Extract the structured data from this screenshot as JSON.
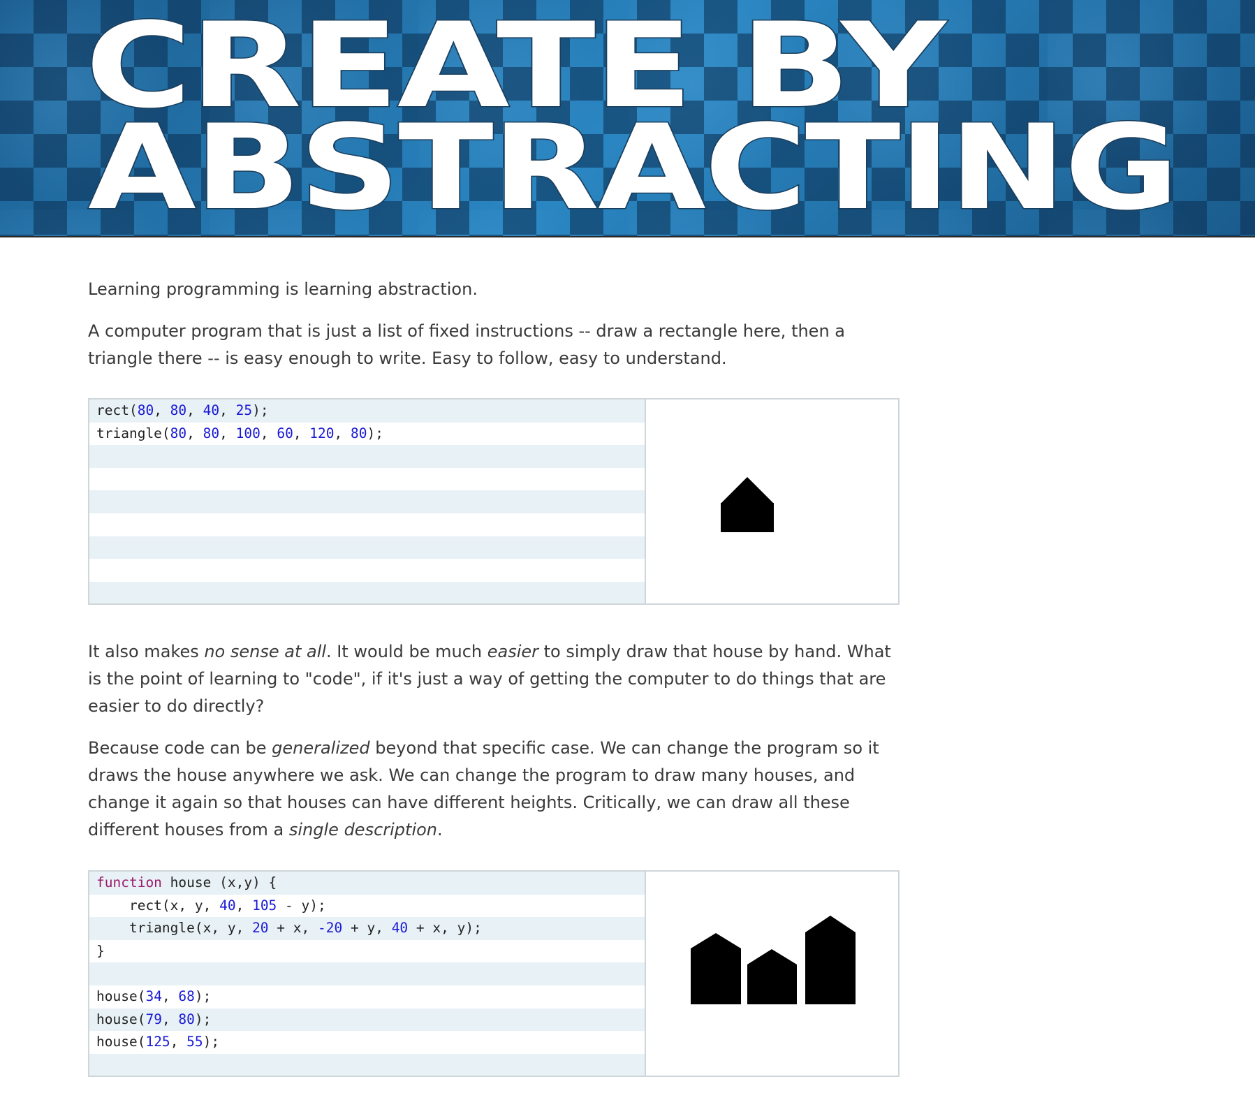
{
  "banner": {
    "line1": "CREATE BY",
    "line2": "ABSTRACTING"
  },
  "intro": {
    "p1": "Learning programming is learning abstraction.",
    "p2": "A computer program that is just a list of fixed instructions -- draw a rectangle here, then a triangle there -- is easy enough to write. Easy to follow, easy to understand."
  },
  "example1": {
    "code_lines": [
      [
        {
          "t": "rect("
        },
        {
          "t": "80",
          "n": true
        },
        {
          "t": ", "
        },
        {
          "t": "80",
          "n": true
        },
        {
          "t": ", "
        },
        {
          "t": "40",
          "n": true
        },
        {
          "t": ", "
        },
        {
          "t": "25",
          "n": true
        },
        {
          "t": ");"
        }
      ],
      [
        {
          "t": "triangle("
        },
        {
          "t": "80",
          "n": true
        },
        {
          "t": ", "
        },
        {
          "t": "80",
          "n": true
        },
        {
          "t": ", "
        },
        {
          "t": "100",
          "n": true
        },
        {
          "t": ", "
        },
        {
          "t": "60",
          "n": true
        },
        {
          "t": ", "
        },
        {
          "t": "120",
          "n": true
        },
        {
          "t": ", "
        },
        {
          "t": "80",
          "n": true
        },
        {
          "t": ");"
        }
      ],
      [],
      [],
      [],
      [],
      [],
      [],
      []
    ]
  },
  "middle": {
    "p3_parts": [
      {
        "t": "It also makes "
      },
      {
        "t": "no sense at all",
        "em": true
      },
      {
        "t": ". It would be much "
      },
      {
        "t": "easier",
        "em": true
      },
      {
        "t": " to simply draw that house by hand. What is the point of learning to \"code\", if it's just a way of getting the computer to do things that are easier to do directly?"
      }
    ],
    "p4_parts": [
      {
        "t": "Because code can be "
      },
      {
        "t": "generalized",
        "em": true
      },
      {
        "t": " beyond that specific case. We can change the program so it draws the house anywhere we ask. We can change the program to draw many houses, and change it again so that houses can have different heights. Critically, we can draw all these different houses from a "
      },
      {
        "t": "single description",
        "em": true
      },
      {
        "t": "."
      }
    ]
  },
  "example2": {
    "code_lines": [
      [
        {
          "t": "function",
          "k": true
        },
        {
          "t": " house (x,y) {"
        }
      ],
      [
        {
          "t": "    rect(x, y, "
        },
        {
          "t": "40",
          "n": true
        },
        {
          "t": ", "
        },
        {
          "t": "105",
          "n": true
        },
        {
          "t": " - y);"
        }
      ],
      [
        {
          "t": "    triangle(x, y, "
        },
        {
          "t": "20",
          "n": true
        },
        {
          "t": " + x, "
        },
        {
          "t": "-20",
          "n": true
        },
        {
          "t": " + y, "
        },
        {
          "t": "40",
          "n": true
        },
        {
          "t": " + x, y);"
        }
      ],
      [
        {
          "t": "}"
        }
      ],
      [],
      [
        {
          "t": "house("
        },
        {
          "t": "34",
          "n": true
        },
        {
          "t": ", "
        },
        {
          "t": "68",
          "n": true
        },
        {
          "t": ");"
        }
      ],
      [
        {
          "t": "house("
        },
        {
          "t": "79",
          "n": true
        },
        {
          "t": ", "
        },
        {
          "t": "80",
          "n": true
        },
        {
          "t": ");"
        }
      ],
      [
        {
          "t": "house("
        },
        {
          "t": "125",
          "n": true
        },
        {
          "t": ", "
        },
        {
          "t": "55",
          "n": true
        },
        {
          "t": ");"
        }
      ],
      []
    ]
  },
  "colors": {
    "number": "#1a1ad6",
    "keyword": "#9b1a6b",
    "banner_blue": "#1f6fa5"
  }
}
